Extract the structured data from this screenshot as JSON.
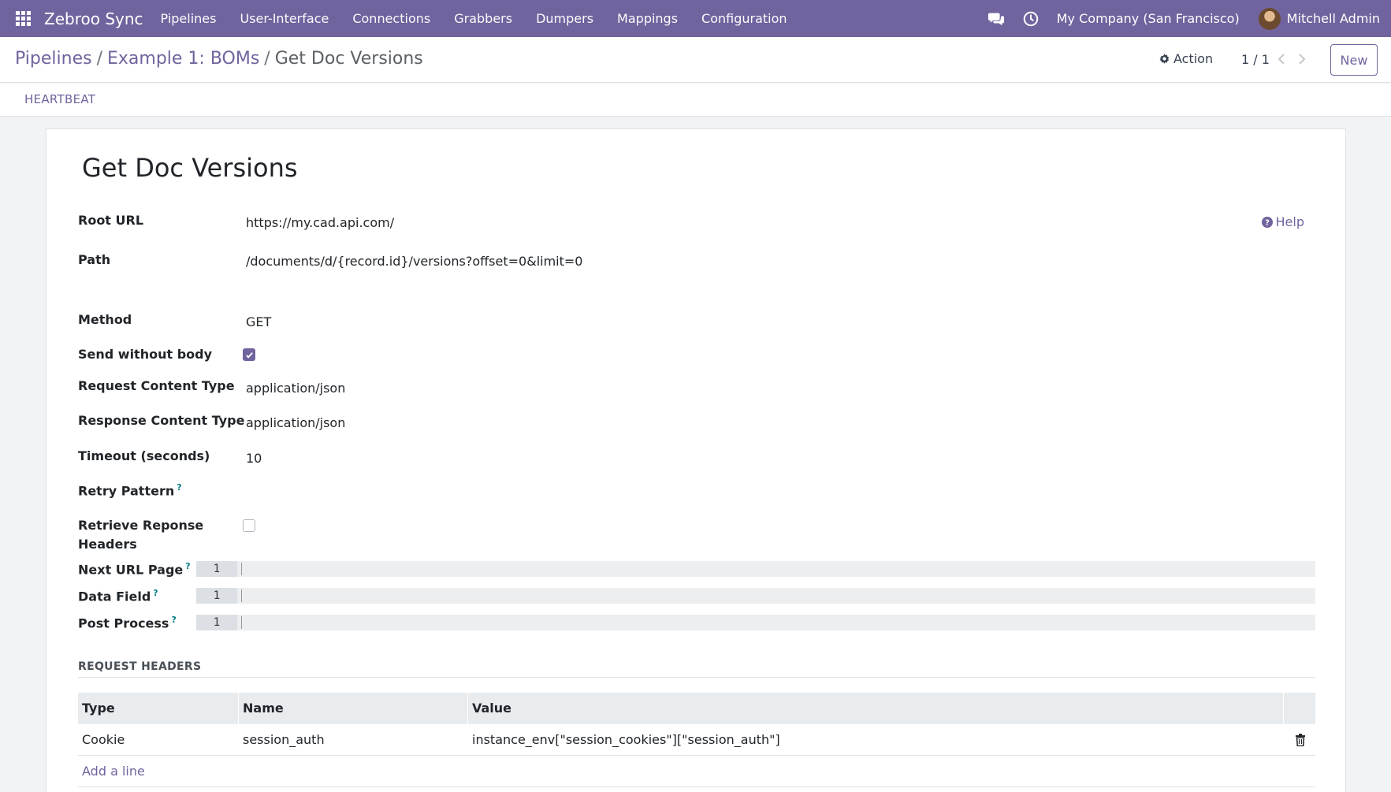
{
  "navbar": {
    "brand": "Zebroo Sync",
    "menu": [
      "Pipelines",
      "User-Interface",
      "Connections",
      "Grabbers",
      "Dumpers",
      "Mappings",
      "Configuration"
    ],
    "company": "My Company (San Francisco)",
    "user": "Mitchell Admin",
    "icons": [
      "apps-icon",
      "chat-icon",
      "clock-icon",
      "avatar"
    ],
    "color": "#71639e"
  },
  "breadcrumb": {
    "items": [
      "Pipelines",
      "Example 1: BOMs"
    ],
    "current": "Get Doc Versions"
  },
  "control": {
    "action_label": "Action",
    "pager": "1 / 1",
    "new_label": "New"
  },
  "statusbar": {
    "button": "HEARTBEAT"
  },
  "form": {
    "title": "Get Doc Versions",
    "help_label": "Help",
    "root_url_label": "Root URL",
    "root_url": "https://my.cad.api.com/",
    "path_label": "Path",
    "path": "/documents/d/{record.id}/versions?offset=0&limit=0",
    "method_label": "Method",
    "method": "GET",
    "send_without_body_label": "Send without body",
    "send_without_body": true,
    "request_content_type_label": "Request Content Type",
    "request_content_type": "application/json",
    "response_content_type_label": "Response Content Type",
    "response_content_type": "application/json",
    "timeout_label": "Timeout (seconds)",
    "timeout": "10",
    "retry_pattern_label": "Retry Pattern",
    "retrieve_headers_label_1": "Retrieve Reponse",
    "retrieve_headers_label_2": "Headers",
    "retrieve_headers": false,
    "next_url_page_label": "Next URL Page",
    "data_field_label": "Data Field",
    "post_process_label": "Post Process",
    "line_number": "1",
    "tooltip_mark": "?"
  },
  "request_headers": {
    "section_title": "REQUEST HEADERS",
    "columns": [
      "Type",
      "Name",
      "Value"
    ],
    "rows": [
      {
        "type": "Cookie",
        "name": "session_auth",
        "value": "instance_env[\"session_cookies\"][\"session_auth\"]"
      }
    ],
    "add_line": "Add a line"
  }
}
